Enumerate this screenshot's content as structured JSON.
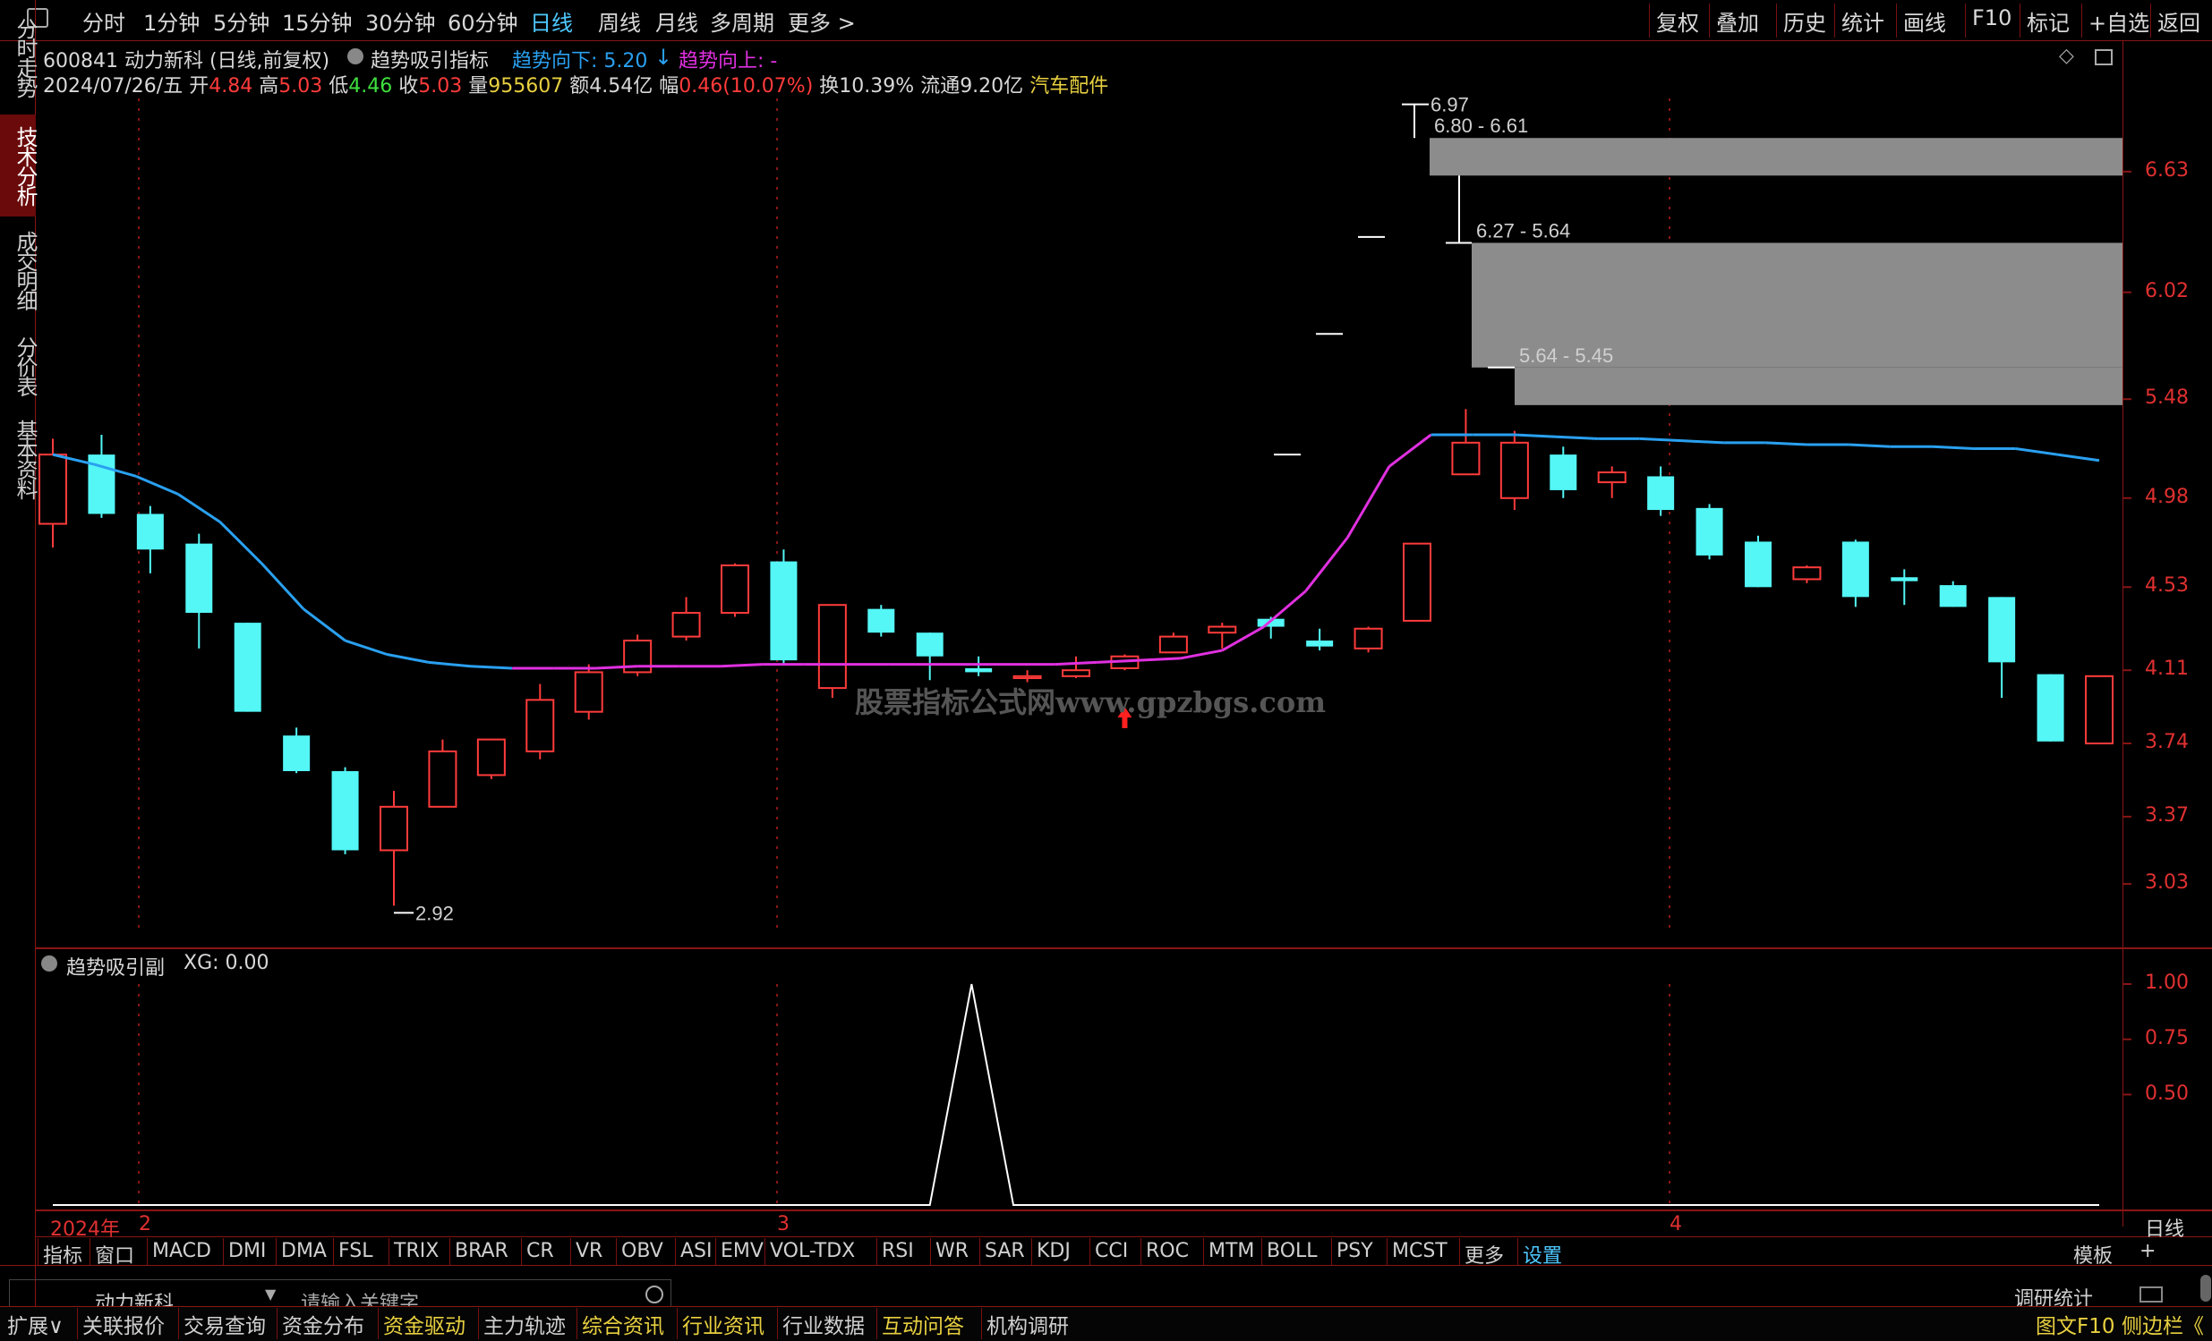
{
  "toolbar": {
    "periods": [
      "分时",
      "1分钟",
      "5分钟",
      "15分钟",
      "30分钟",
      "60分钟",
      "日线",
      "周线",
      "月线",
      "多周期",
      "更多 >"
    ],
    "active_period": "日线",
    "right_buttons": [
      "复权",
      "叠加",
      "历史",
      "统计",
      "画线",
      "F10",
      "标记",
      "+自选",
      "返回"
    ]
  },
  "left_tabs": [
    {
      "label": "分时走势",
      "active": false
    },
    {
      "label": "技术分析",
      "active": true
    },
    {
      "label": "成交明细",
      "active": false
    },
    {
      "label": "分价表",
      "active": false
    },
    {
      "label": "基本资料",
      "active": false
    }
  ],
  "header": {
    "code_name": "600841 动力新科 (日线,前复权)",
    "indicator_name": "趋势吸引指标",
    "trend_down": "趋势向下: 5.20",
    "trend_up": "趋势向上: -"
  },
  "quote": {
    "date": "2024/07/26/五",
    "open_label": "开",
    "open": "4.84",
    "high_label": "高",
    "high": "5.03",
    "low_label": "低",
    "low": "4.46",
    "close_label": "收",
    "close": "5.03",
    "vol_label": "量",
    "vol": "955607",
    "amount_label": "额",
    "amount": "4.54亿",
    "change_label": "幅",
    "change": "0.46(10.07%)",
    "turnover": "换10.39%",
    "float": "流通9.20亿",
    "sector": "汽车配件"
  },
  "chart_data": {
    "type": "candlestick",
    "y_ticks": [
      "6.63",
      "6.02",
      "5.48",
      "4.98",
      "4.53",
      "4.11",
      "3.74",
      "3.37",
      "3.03"
    ],
    "ylim": [
      2.75,
      7.0
    ],
    "x_labels": [
      "2024年",
      "2",
      "3",
      "4"
    ],
    "period_label": "日线",
    "candles": [
      {
        "o": 4.85,
        "c": 5.2,
        "h": 5.28,
        "l": 4.73,
        "up": true
      },
      {
        "o": 5.2,
        "c": 4.9,
        "h": 5.3,
        "l": 4.88,
        "up": false
      },
      {
        "o": 4.9,
        "c": 4.72,
        "h": 4.94,
        "l": 4.6,
        "up": false
      },
      {
        "o": 4.75,
        "c": 4.4,
        "h": 4.8,
        "l": 4.22,
        "up": false
      },
      {
        "o": 4.35,
        "c": 3.9,
        "h": 4.35,
        "l": 3.9,
        "up": false
      },
      {
        "o": 3.78,
        "c": 3.6,
        "h": 3.82,
        "l": 3.59,
        "up": false
      },
      {
        "o": 3.6,
        "c": 3.2,
        "h": 3.62,
        "l": 3.18,
        "up": false
      },
      {
        "o": 3.2,
        "c": 3.42,
        "h": 3.5,
        "l": 2.92,
        "up": true
      },
      {
        "o": 3.42,
        "c": 3.7,
        "h": 3.76,
        "l": 3.42,
        "up": true
      },
      {
        "o": 3.58,
        "c": 3.76,
        "h": 3.76,
        "l": 3.56,
        "up": true
      },
      {
        "o": 3.7,
        "c": 3.96,
        "h": 4.04,
        "l": 3.66,
        "up": true
      },
      {
        "o": 3.9,
        "c": 4.1,
        "h": 4.14,
        "l": 3.86,
        "up": true
      },
      {
        "o": 4.1,
        "c": 4.26,
        "h": 4.29,
        "l": 4.08,
        "up": true
      },
      {
        "o": 4.28,
        "c": 4.4,
        "h": 4.48,
        "l": 4.26,
        "up": true
      },
      {
        "o": 4.4,
        "c": 4.64,
        "h": 4.65,
        "l": 4.38,
        "up": true
      },
      {
        "o": 4.66,
        "c": 4.16,
        "h": 4.72,
        "l": 4.14,
        "up": false
      },
      {
        "o": 4.02,
        "c": 4.44,
        "h": 4.44,
        "l": 3.97,
        "up": true
      },
      {
        "o": 4.42,
        "c": 4.3,
        "h": 4.44,
        "l": 4.28,
        "up": false
      },
      {
        "o": 4.3,
        "c": 4.18,
        "h": 4.3,
        "l": 4.06,
        "up": false
      },
      {
        "o": 4.12,
        "c": 4.1,
        "h": 4.18,
        "l": 4.08,
        "up": false
      },
      {
        "o": 4.07,
        "c": 4.08,
        "h": 4.11,
        "l": 4.05,
        "up": true
      },
      {
        "o": 4.08,
        "c": 4.11,
        "h": 4.18,
        "l": 4.07,
        "up": true
      },
      {
        "o": 4.12,
        "c": 4.18,
        "h": 4.19,
        "l": 4.11,
        "up": true
      },
      {
        "o": 4.2,
        "c": 4.28,
        "h": 4.3,
        "l": 4.2,
        "up": true
      },
      {
        "o": 4.3,
        "c": 4.33,
        "h": 4.35,
        "l": 4.22,
        "up": true
      },
      {
        "o": 4.37,
        "c": 4.33,
        "h": 4.38,
        "l": 4.27,
        "up": false
      },
      {
        "o": 4.26,
        "c": 4.23,
        "h": 4.32,
        "l": 4.21,
        "up": false
      },
      {
        "o": 4.22,
        "c": 4.32,
        "h": 4.33,
        "l": 4.2,
        "up": true
      },
      {
        "o": 4.36,
        "c": 4.75,
        "h": 4.75,
        "l": 4.36,
        "up": true
      },
      {
        "o": 5.1,
        "c": 5.26,
        "h": 5.43,
        "l": 5.1,
        "up": true
      },
      {
        "o": 5.26,
        "c": 4.98,
        "h": 5.32,
        "l": 4.92,
        "up": true
      },
      {
        "o": 5.2,
        "c": 5.02,
        "h": 5.24,
        "l": 4.98,
        "up": false
      },
      {
        "o": 5.06,
        "c": 5.11,
        "h": 5.14,
        "l": 4.98,
        "up": true
      },
      {
        "o": 5.09,
        "c": 4.92,
        "h": 5.14,
        "l": 4.89,
        "up": false
      },
      {
        "o": 4.93,
        "c": 4.69,
        "h": 4.95,
        "l": 4.67,
        "up": false
      },
      {
        "o": 4.76,
        "c": 4.53,
        "h": 4.79,
        "l": 4.53,
        "up": false
      },
      {
        "o": 4.63,
        "c": 4.57,
        "h": 4.64,
        "l": 4.55,
        "up": true
      },
      {
        "o": 4.76,
        "c": 4.48,
        "h": 4.77,
        "l": 4.43,
        "up": false
      },
      {
        "o": 4.58,
        "c": 4.56,
        "h": 4.62,
        "l": 4.44,
        "up": false
      },
      {
        "o": 4.54,
        "c": 4.43,
        "h": 4.56,
        "l": 4.43,
        "up": false
      },
      {
        "o": 4.48,
        "c": 4.15,
        "h": 4.48,
        "l": 3.97,
        "up": false
      },
      {
        "o": 4.09,
        "c": 3.75,
        "h": 4.09,
        "l": 3.75,
        "up": false
      },
      {
        "o": 3.74,
        "c": 4.08,
        "h": 4.08,
        "l": 3.74,
        "up": true
      }
    ],
    "trend_line": [
      5.2,
      5.15,
      5.09,
      5.0,
      4.86,
      4.65,
      4.42,
      4.26,
      4.19,
      4.15,
      4.13,
      4.12,
      4.12,
      4.12,
      4.13,
      4.13,
      4.13,
      4.14,
      4.14,
      4.14,
      4.14,
      4.14,
      4.14,
      4.14,
      4.14,
      4.15,
      4.16,
      4.17,
      4.21,
      4.33,
      4.51,
      4.78,
      5.14,
      5.3,
      5.3,
      5.3,
      5.29,
      5.28,
      5.28,
      5.27,
      5.26,
      5.26,
      5.25,
      5.25,
      5.24,
      5.24,
      5.23,
      5.23,
      5.2,
      5.17
    ],
    "trend_magenta_range": [
      11,
      33
    ],
    "price_zones": [
      {
        "label": "6.80 - 6.61",
        "top": 6.8,
        "bottom": 6.61
      },
      {
        "label": "6.27 - 5.64",
        "top": 6.27,
        "bottom": 5.64
      },
      {
        "label": "5.64 - 5.45",
        "top": 5.64,
        "bottom": 5.45
      }
    ],
    "high_marker": "6.97",
    "low_marker": "2.92",
    "sub_indicator": {
      "name": "趋势吸引副",
      "value_label": "XG: 0.00",
      "y_ticks": [
        "1.00",
        "0.75",
        "0.50"
      ],
      "ylim": [
        0,
        1.0
      ],
      "values": [
        0,
        0,
        0,
        0,
        0,
        0,
        0,
        0,
        0,
        0,
        0,
        0,
        0,
        0,
        0,
        0,
        0,
        0,
        0,
        0,
        0,
        0,
        1,
        0,
        0,
        0,
        0,
        0,
        0,
        0,
        0,
        0,
        0,
        0,
        0,
        0,
        0,
        0,
        0,
        0,
        0,
        0,
        0,
        0,
        0,
        0,
        0,
        0,
        0,
        0
      ]
    }
  },
  "watermark": "股票指标公式网www.gpzbgs.com",
  "bottom_tabs": [
    "指标",
    "窗口",
    "MACD",
    "DMI",
    "DMA",
    "FSL",
    "TRIX",
    "BRAR",
    "CR",
    "VR",
    "OBV",
    "ASI",
    "EMV",
    "VOL-TDX",
    "RSI",
    "WR",
    "SAR",
    "KDJ",
    "CCI",
    "ROC",
    "MTM",
    "BOLL",
    "PSY",
    "MCST",
    "更多",
    "设置"
  ],
  "bottom_right": [
    "模板",
    "+"
  ],
  "search": {
    "stock": "动力新科",
    "placeholder": "请输入关键字",
    "right_label": "调研统计"
  },
  "status_bar": [
    "扩展∨",
    "关联报价",
    "交易查询",
    "资金分布",
    "资金驱动",
    "主力轨迹",
    "综合资讯",
    "行业资讯",
    "行业数据",
    "互动问答",
    "机构调研"
  ],
  "status_right": [
    "图文F10",
    "侧边栏《"
  ],
  "colors": {
    "up": "#ff3b3b",
    "down": "#54f6f6",
    "trend_blue": "#2aa0f0",
    "trend_magenta": "#e030e0",
    "zone": "#8c8c8c",
    "grid": "#8a1515"
  }
}
